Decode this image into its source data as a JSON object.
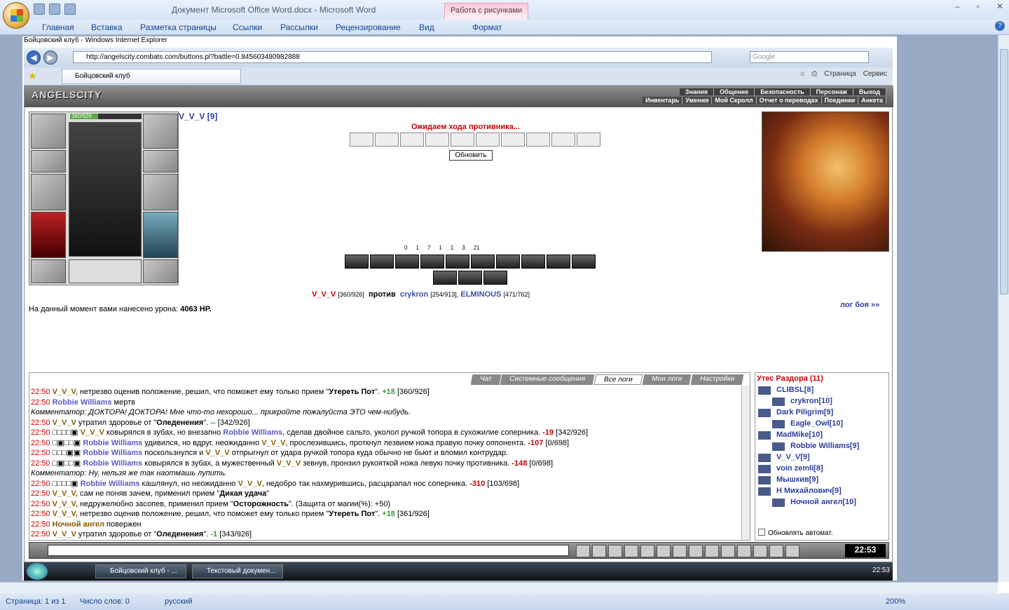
{
  "word": {
    "title": "Документ Microsoft Office Word.docx - Microsoft Word",
    "context_tab": "Работа с рисунками",
    "tabs": [
      "Главная",
      "Вставка",
      "Разметка страницы",
      "Ссылки",
      "Рассылки",
      "Рецензирование",
      "Вид",
      "Формат"
    ],
    "status": {
      "page": "Страница: 1 из 1",
      "words": "Число слов: 0",
      "lang": "русский",
      "zoom": "200%"
    }
  },
  "ie": {
    "title": "Бойцовский клуб - Windows Internet Explorer",
    "url": "http://angelscity.combats.com/buttons.pl?battle=0.845603480982888",
    "search_placeholder": "Google",
    "tab": "Бойцовский клуб",
    "tools": [
      "Страница",
      "Сервис"
    ]
  },
  "game": {
    "logo": "ANGELSCITY",
    "menu_top": [
      "Знания",
      "Общение",
      "Безопасность",
      "Персонаж",
      "Выход"
    ],
    "menu_bottom": [
      "Инвентарь",
      "Умения",
      "Мой Скролл",
      "Отчет о переводах",
      "Поединки",
      "Анкета"
    ],
    "hp": "360/926",
    "player": "V_V_V [9]",
    "waiting": "Ожидаем хода противника...",
    "refresh": "Обновить",
    "stats": [
      "0",
      "1",
      "7",
      "1",
      "1",
      "3",
      "21"
    ],
    "versus": {
      "me": "V_V_V",
      "me_hp": "[360/926]",
      "vs": "против",
      "e1": "crykron",
      "e1_hp": "[254/913],",
      "e2": "ELMINOUS",
      "e2_hp": "[471/762]"
    },
    "damage_text": "На данный момент вами нанесено урона:",
    "damage_value": "4063 HP.",
    "fight_log": "лог боя »»",
    "chat_tabs": [
      "Чат",
      "Системные сообщения",
      "Все логи",
      "Мои логи",
      "Настройки"
    ],
    "users_title": "Утес Раздора (11)",
    "users": [
      "CLIBSL[8]",
      "crykron[10]",
      "Dark Piligrim[9]",
      "Eagle_Owl[10]",
      "MadMike[10]",
      "Robbie Williams[9]",
      "V_V_V[9]",
      "voin zemli[8]",
      "Мышкив[9]",
      "Н Михайлович[9]",
      "Ночной ангел[10]"
    ],
    "auto_refresh": "Обновлять автомат.",
    "clock": "22:53"
  },
  "taskbar": {
    "items": [
      "Бойцовский клуб - ...",
      "Текстовый докумен..."
    ],
    "time": "22:53"
  }
}
